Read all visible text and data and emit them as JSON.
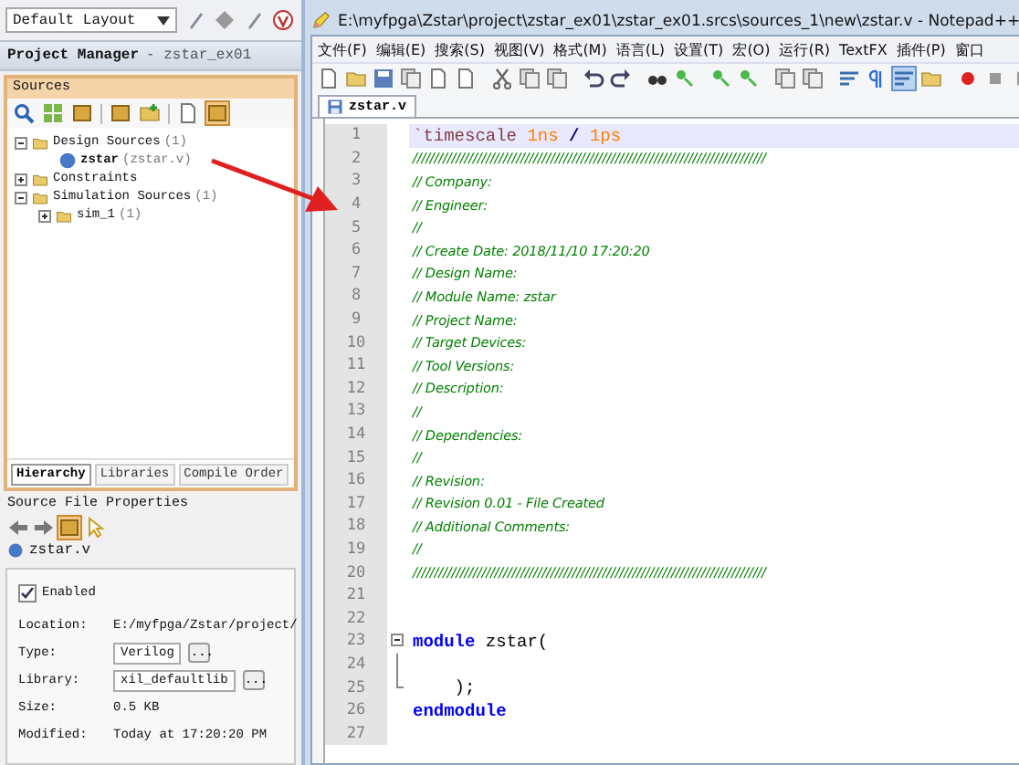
{
  "layout_dropdown": {
    "value": "Default Layout"
  },
  "project_manager": {
    "title": "Project Manager",
    "project": "- zstar_ex01"
  },
  "sources": {
    "title": "Sources",
    "tree": [
      {
        "label": "Design Sources",
        "count": "(1)",
        "expanded": true,
        "children": [
          {
            "label": "zstar",
            "detail": "(zstar.v)"
          }
        ]
      },
      {
        "label": "Constraints",
        "expanded": false
      },
      {
        "label": "Simulation Sources",
        "count": "(1)",
        "expanded": true,
        "children": [
          {
            "label": "sim_1",
            "count": "(1)",
            "expanded": false
          }
        ]
      }
    ],
    "tabs": [
      {
        "label": "Hierarchy",
        "selected": true
      },
      {
        "label": "Libraries",
        "selected": false
      },
      {
        "label": "Compile Order",
        "selected": false
      }
    ]
  },
  "properties": {
    "title": "Source File Properties",
    "file": "zstar.v",
    "enabled": {
      "label": "Enabled",
      "checked": true
    },
    "rows": [
      {
        "label": "Location:",
        "value": "E:/myfpga/Zstar/project/",
        "kind": "text"
      },
      {
        "label": "Type:",
        "value": "Verilog",
        "kind": "select",
        "button": "..."
      },
      {
        "label": "Library:",
        "value": "xil_defaultlib",
        "kind": "select",
        "button": "..."
      },
      {
        "label": "Size:",
        "value": "0.5 KB",
        "kind": "text"
      },
      {
        "label": "Modified:",
        "value": "Today at 17:20:20 PM",
        "kind": "text"
      }
    ]
  },
  "editor": {
    "title": "E:\\myfpga\\Zstar\\project\\zstar_ex01\\zstar_ex01.srcs\\sources_1\\new\\zstar.v - Notepad++",
    "menu": [
      "文件(F)",
      "编辑(E)",
      "搜索(S)",
      "视图(V)",
      "格式(M)",
      "语言(L)",
      "设置(T)",
      "宏(O)",
      "运行(R)",
      "TextFX",
      "插件(P)",
      "窗口"
    ],
    "tab": {
      "label": "zstar.v"
    },
    "lines": [
      {
        "number": "1",
        "kind": "code",
        "current": true,
        "tokens": [
          {
            "kind": "directive",
            "text": "`timescale "
          },
          {
            "kind": "number",
            "text": "1ns"
          },
          {
            "kind": "operator",
            "text": " / "
          },
          {
            "kind": "number",
            "text": "1ps"
          }
        ]
      },
      {
        "number": "2",
        "kind": "code",
        "current": false,
        "tokens": [
          {
            "kind": "comment",
            "text": "//////////////////////////////////////////////////////////////////////////////////"
          }
        ]
      },
      {
        "number": "3",
        "kind": "code",
        "current": false,
        "tokens": [
          {
            "kind": "comment",
            "text": "// Company:"
          }
        ]
      },
      {
        "number": "4",
        "kind": "code",
        "current": false,
        "tokens": [
          {
            "kind": "comment",
            "text": "// Engineer:"
          }
        ]
      },
      {
        "number": "5",
        "kind": "code",
        "current": false,
        "tokens": [
          {
            "kind": "comment",
            "text": "//"
          }
        ]
      },
      {
        "number": "6",
        "kind": "code",
        "current": false,
        "tokens": [
          {
            "kind": "comment",
            "text": "// Create Date: 2018/11/10 17:20:20"
          }
        ]
      },
      {
        "number": "7",
        "kind": "code",
        "current": false,
        "tokens": [
          {
            "kind": "comment",
            "text": "// Design Name:"
          }
        ]
      },
      {
        "number": "8",
        "kind": "code",
        "current": false,
        "tokens": [
          {
            "kind": "comment",
            "text": "// Module Name: zstar"
          }
        ]
      },
      {
        "number": "9",
        "kind": "code",
        "current": false,
        "tokens": [
          {
            "kind": "comment",
            "text": "// Project Name:"
          }
        ]
      },
      {
        "number": "10",
        "kind": "code",
        "current": false,
        "tokens": [
          {
            "kind": "comment",
            "text": "// Target Devices:"
          }
        ]
      },
      {
        "number": "11",
        "kind": "code",
        "current": false,
        "tokens": [
          {
            "kind": "comment",
            "text": "// Tool Versions:"
          }
        ]
      },
      {
        "number": "12",
        "kind": "code",
        "current": false,
        "tokens": [
          {
            "kind": "comment",
            "text": "// Description:"
          }
        ]
      },
      {
        "number": "13",
        "kind": "code",
        "current": false,
        "tokens": [
          {
            "kind": "comment",
            "text": "//"
          }
        ]
      },
      {
        "number": "14",
        "kind": "code",
        "current": false,
        "tokens": [
          {
            "kind": "comment",
            "text": "// Dependencies:"
          }
        ]
      },
      {
        "number": "15",
        "kind": "code",
        "current": false,
        "tokens": [
          {
            "kind": "comment",
            "text": "//"
          }
        ]
      },
      {
        "number": "16",
        "kind": "code",
        "current": false,
        "tokens": [
          {
            "kind": "comment",
            "text": "// Revision:"
          }
        ]
      },
      {
        "number": "17",
        "kind": "code",
        "current": false,
        "tokens": [
          {
            "kind": "comment",
            "text": "// Revision 0.01 - File Created"
          }
        ]
      },
      {
        "number": "18",
        "kind": "code",
        "current": false,
        "tokens": [
          {
            "kind": "comment",
            "text": "// Additional Comments:"
          }
        ]
      },
      {
        "number": "19",
        "kind": "code",
        "current": false,
        "tokens": [
          {
            "kind": "comment",
            "text": "//"
          }
        ]
      },
      {
        "number": "20",
        "kind": "code",
        "current": false,
        "tokens": [
          {
            "kind": "comment",
            "text": "//////////////////////////////////////////////////////////////////////////////////"
          }
        ]
      },
      {
        "number": "21",
        "kind": "code",
        "current": false
      },
      {
        "number": "22",
        "kind": "code",
        "current": false
      },
      {
        "number": "23",
        "kind": "fold_start",
        "current": false,
        "tokens": [
          {
            "kind": "keyword",
            "text": "module"
          },
          {
            "kind": "plain",
            "text": " zstar("
          }
        ]
      },
      {
        "number": "24",
        "kind": "fold_body",
        "current": false
      },
      {
        "number": "25",
        "kind": "fold_end",
        "current": false,
        "tokens": [
          {
            "kind": "plain",
            "text": "    );"
          }
        ]
      },
      {
        "number": "26",
        "kind": "code",
        "current": false,
        "tokens": [
          {
            "kind": "keyword",
            "text": "endmodule"
          }
        ]
      },
      {
        "number": "27",
        "kind": "code",
        "current": false
      }
    ]
  }
}
